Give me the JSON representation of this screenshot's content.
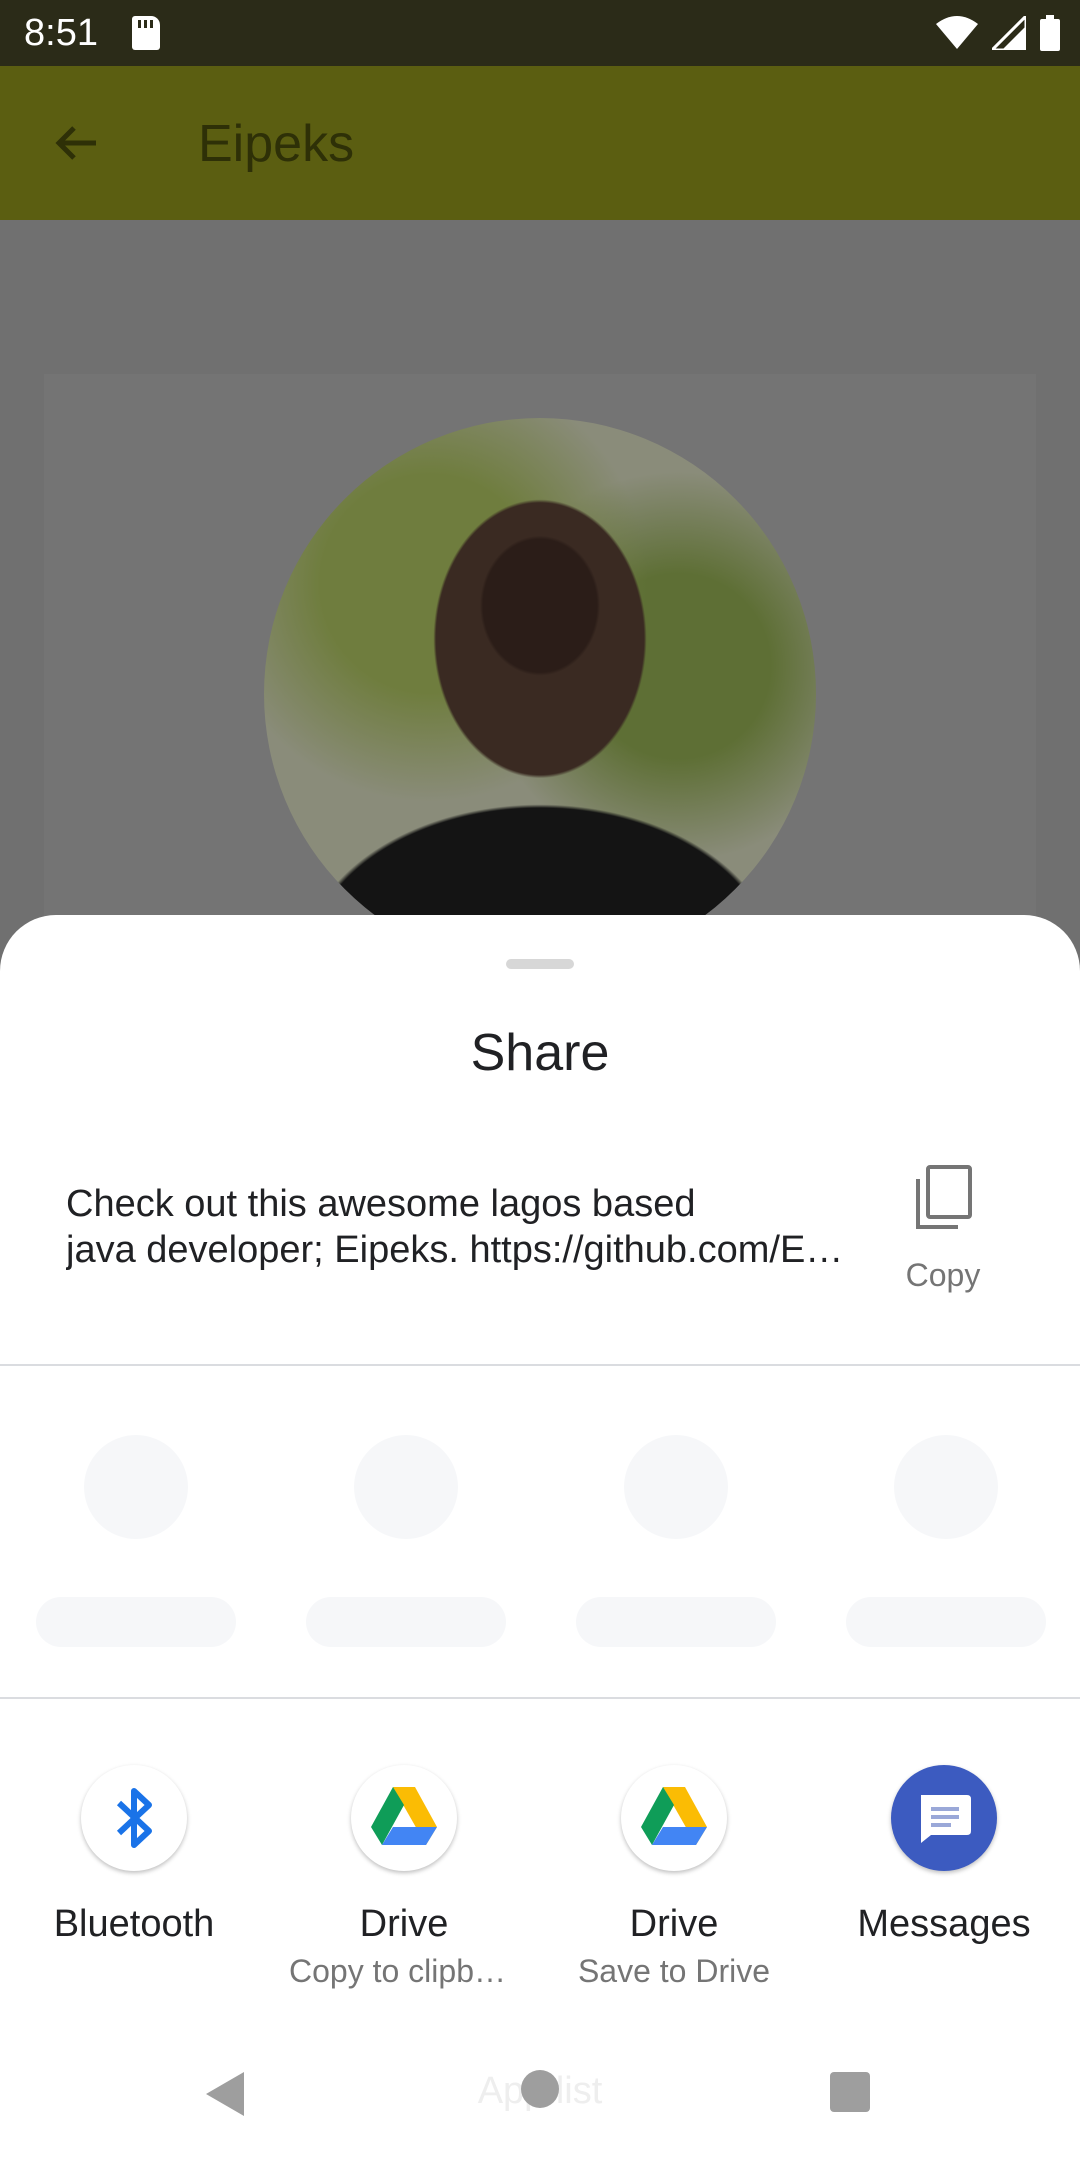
{
  "status_bar": {
    "time": "8:51"
  },
  "app_bar": {
    "title": "Eipeks"
  },
  "share_sheet": {
    "title": "Share",
    "share_text_line1": "Check out this awesome lagos based",
    "share_text_line2": "java developer; Eipeks. https://github.com/Eipeks",
    "copy_label": "Copy",
    "targets": [
      {
        "label": "Bluetooth",
        "sublabel": "",
        "icon": "bluetooth-icon"
      },
      {
        "label": "Drive",
        "sublabel": "Copy to clipboard",
        "icon": "google-drive-icon"
      },
      {
        "label": "Drive",
        "sublabel": "Save to Drive",
        "icon": "google-drive-icon"
      },
      {
        "label": "Messages",
        "sublabel": "",
        "icon": "messages-icon"
      }
    ]
  },
  "nav_bar": {
    "underlying_text": "App list"
  },
  "colors": {
    "status_bar": "#2b2b18",
    "app_bar": "#5b5e11",
    "scrim_content": "#707070",
    "bluetooth_blue": "#1a73e8",
    "messages_blue": "#3c5bc0"
  }
}
